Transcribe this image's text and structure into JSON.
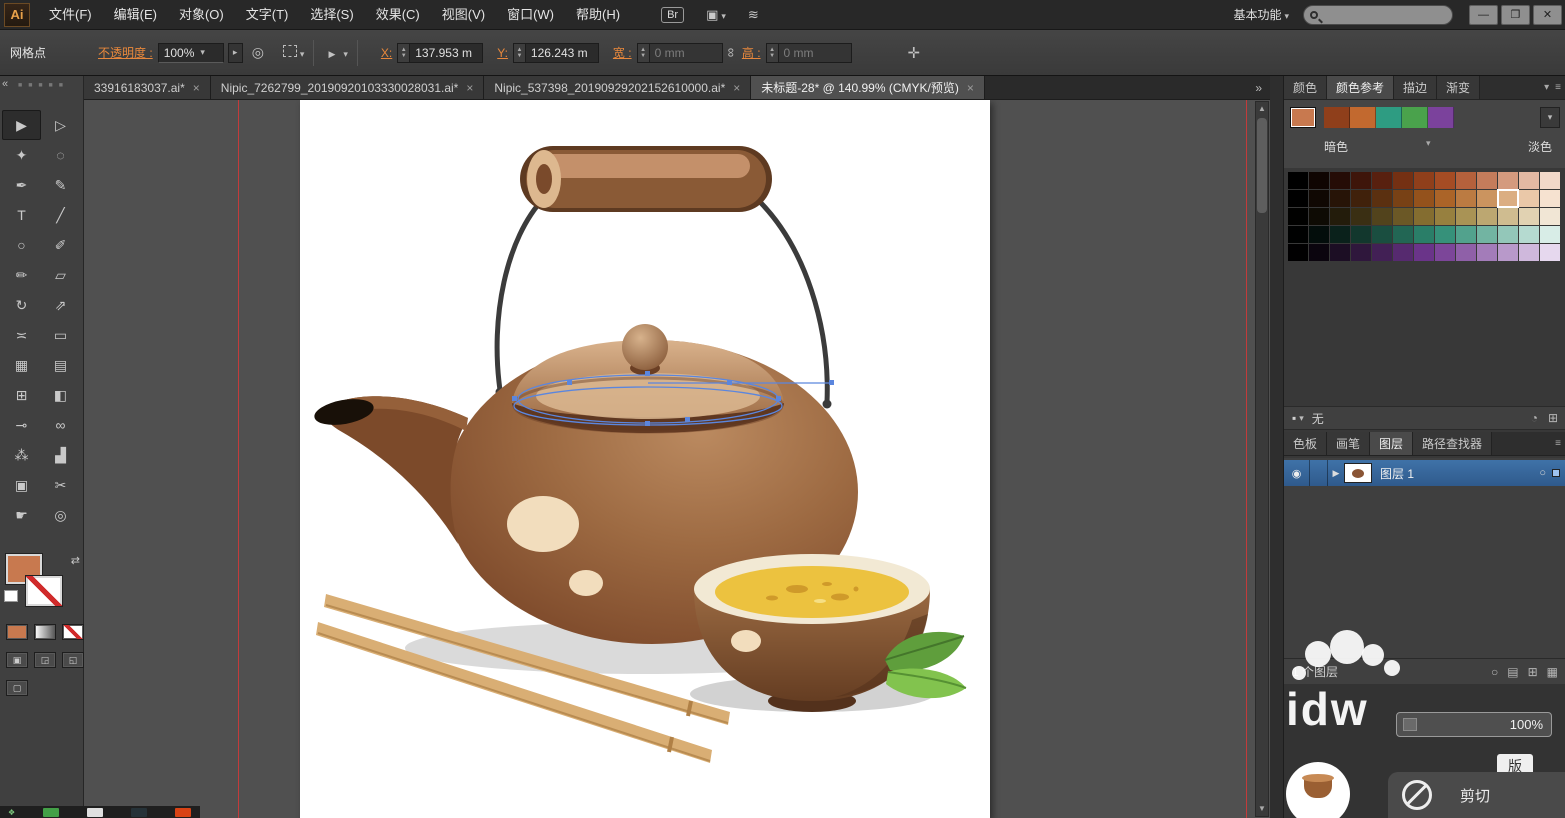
{
  "app": {
    "logo": "Ai"
  },
  "menu": {
    "items": [
      "文件(F)",
      "编辑(E)",
      "对象(O)",
      "文字(T)",
      "选择(S)",
      "效果(C)",
      "视图(V)",
      "窗口(W)",
      "帮助(H)"
    ],
    "br": "Br",
    "workspace": "基本功能"
  },
  "icons": {
    "dropdown": "▾",
    "flyout": "≡",
    "overflow": "»",
    "right_arrow": "▸",
    "target": "◎",
    "chain": "∞",
    "transform": "✛",
    "swap": "⇄",
    "eye": "◉",
    "circle": "○",
    "wave": "≋",
    "layout": "▣",
    "minimize": "—",
    "restore": "❐",
    "close": "✕",
    "collapse": "«",
    "scroll_up": "▲",
    "scroll_down": "▼",
    "expand": "▶",
    "list": "▤",
    "grid": "⊞",
    "blocks": "▦",
    "pie": "◔",
    "chip": "▪"
  },
  "control_bar": {
    "left_label": "网格点",
    "opacity_label": "不透明度 :",
    "opacity_value": "100%",
    "x_label": "X:",
    "x_value": "137.953 m",
    "y_label": "Y:",
    "y_value": "126.243 m",
    "w_label": "宽 :",
    "w_value": "0 mm",
    "h_label": "高 :",
    "h_value": "0 mm"
  },
  "tabs": {
    "close_glyph": "×",
    "items": [
      {
        "label": "33916183037.ai*"
      },
      {
        "label": "Nipic_7262799_20190920103330028031.ai*"
      },
      {
        "label": "Nipic_537398_20190929202152610000.ai*"
      },
      {
        "label": "未标题-28* @ 140.99% (CMYK/预览)",
        "active": true
      }
    ]
  },
  "toolbar": {
    "fill_color": "#c8794f",
    "tools": [
      {
        "name": "selection",
        "glyph": "▶"
      },
      {
        "name": "direct-selection",
        "glyph": "▷"
      },
      {
        "name": "magic-wand",
        "glyph": "✦"
      },
      {
        "name": "lasso",
        "glyph": "◌"
      },
      {
        "name": "pen",
        "glyph": "✒"
      },
      {
        "name": "blob-brush",
        "glyph": "✎"
      },
      {
        "name": "type",
        "glyph": "T"
      },
      {
        "name": "line-segment",
        "glyph": "╱"
      },
      {
        "name": "ellipse",
        "glyph": "○"
      },
      {
        "name": "paintbrush",
        "glyph": "✐"
      },
      {
        "name": "pencil",
        "glyph": "✏"
      },
      {
        "name": "eraser",
        "glyph": "▱"
      },
      {
        "name": "rotate",
        "glyph": "↻"
      },
      {
        "name": "scale",
        "glyph": "⇗"
      },
      {
        "name": "width",
        "glyph": "≍"
      },
      {
        "name": "free-transform",
        "glyph": "▭"
      },
      {
        "name": "shape-builder",
        "glyph": "▦"
      },
      {
        "name": "perspective-grid",
        "glyph": "▤"
      },
      {
        "name": "mesh",
        "glyph": "⊞"
      },
      {
        "name": "gradient",
        "glyph": "◧"
      },
      {
        "name": "eyedropper",
        "glyph": "⊸"
      },
      {
        "name": "blend",
        "glyph": "∞"
      },
      {
        "name": "symbol-sprayer",
        "glyph": "⁂"
      },
      {
        "name": "column-graph",
        "glyph": "▟"
      },
      {
        "name": "artboard",
        "glyph": "▣"
      },
      {
        "name": "slice",
        "glyph": "✂"
      },
      {
        "name": "hand",
        "glyph": "☛"
      },
      {
        "name": "zoom",
        "glyph": "◎"
      }
    ]
  },
  "right_panel": {
    "color_tabs": [
      "颜色",
      "颜色参考",
      "描边",
      "渐变"
    ],
    "color_guide": {
      "current_color": "#c8794f",
      "harmony_colors": [
        "#8f3f1b",
        "#c2692f",
        "#2e9c82",
        "#4aa24c",
        "#7b429c"
      ],
      "dark_label": "暗色",
      "light_label": "淡色",
      "none_label": "无",
      "selected_swatch": {
        "row": 1,
        "col": 10
      },
      "swatch_rows": [
        [
          "#000000",
          "#0f0502",
          "#250c06",
          "#3e150a",
          "#58200f",
          "#743013",
          "#8f3f1b",
          "#a54c24",
          "#b5613c",
          "#c47c5b",
          "#d49a7e",
          "#e3b9a3",
          "#f1d8c9"
        ],
        [
          "#000000",
          "#100803",
          "#271407",
          "#40210b",
          "#5b3010",
          "#784115",
          "#94521c",
          "#ab6428",
          "#bb7b42",
          "#cb945f",
          "#dbae82",
          "#eac8a8",
          "#f6e2d0"
        ],
        [
          "#010100",
          "#0e0b04",
          "#231c0b",
          "#3a2f13",
          "#52431c",
          "#6b5826",
          "#846d30",
          "#97803f",
          "#a99355",
          "#bca771",
          "#cfbc90",
          "#e1d2b2",
          "#f1e6d5"
        ],
        [
          "#000101",
          "#030d0b",
          "#0a211b",
          "#12372d",
          "#1a4e40",
          "#226654",
          "#2a7e68",
          "#36917a",
          "#52a28d",
          "#72b4a2",
          "#93c7b9",
          "#b5dad0",
          "#d8ede7"
        ],
        [
          "#010001",
          "#0b050e",
          "#1c0e24",
          "#2f173c",
          "#422055",
          "#562a6f",
          "#6a3489",
          "#7c4699",
          "#8f60a8",
          "#a37cb9",
          "#b899ca",
          "#cfb8dc",
          "#e6d8ee"
        ]
      ]
    },
    "panel_tabs": [
      "色板",
      "画笔",
      "图层",
      "路径查找器"
    ],
    "layers": {
      "layer_name": "图层 1",
      "count_label": "1 个图层"
    }
  },
  "watermark": {
    "brand": "idw",
    "zoom_value": "100%",
    "menu_item": "剪切",
    "chip": "版"
  },
  "taskbar": {
    "colors": [
      "#43a047",
      "#e0e0e0",
      "#263238",
      "#d84315"
    ]
  },
  "illustration": {
    "palette": {
      "body": "#8a5535",
      "body_light": "#b5835c",
      "lid": "#c49a76",
      "bamboo": "#8a5a36",
      "cream": "#f2ddbd",
      "tea": "#ecc23f",
      "leaf_dark": "#5f9e3c",
      "leaf_light": "#82c34e",
      "wire": "#3b3b3b",
      "chopstick": "#d9ae74",
      "selection_blue": "#5b86de"
    }
  }
}
